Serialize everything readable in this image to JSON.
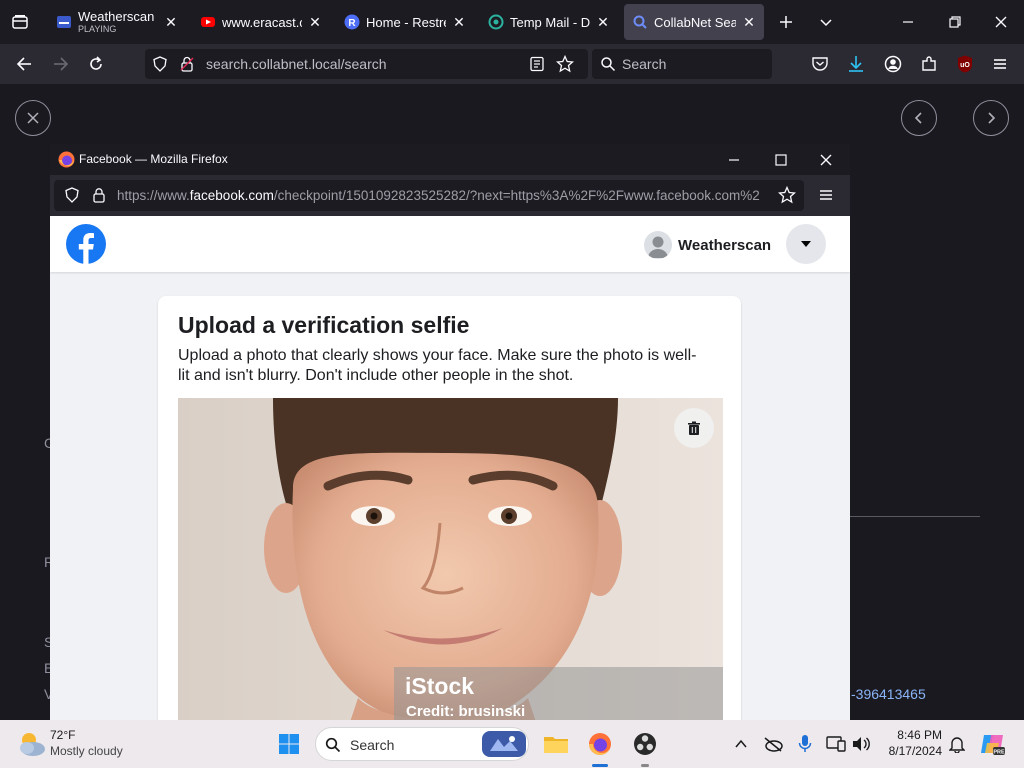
{
  "browser": {
    "tabs": [
      {
        "title": "Weatherscan",
        "subtitle": "PLAYING",
        "icon": "weatherscan-icon",
        "active": false
      },
      {
        "title": "www.eracast.cc",
        "icon": "youtube-icon",
        "active": false
      },
      {
        "title": "Home - Restrea",
        "icon": "restream-icon",
        "active": false
      },
      {
        "title": "Temp Mail - Dis",
        "icon": "tempmail-icon",
        "active": false
      },
      {
        "title": "CollabNet Sear",
        "icon": "search-icon",
        "active": true
      }
    ],
    "address": "search.collabnet.local/search",
    "search_placeholder": "Search"
  },
  "background_page": {
    "link_text": "-396413465",
    "fragment_letters": [
      "C",
      "R",
      "S",
      "E",
      "V"
    ]
  },
  "popup": {
    "window_title": "Facebook — Mozilla Firefox",
    "url_prefix": "https://www.",
    "url_domain": "facebook.com",
    "url_rest": "/checkpoint/1501092823525282/?next=https%3A%2F%2Fwww.facebook.com%2",
    "profile_name": "Weatherscan",
    "card_title": "Upload a verification selfie",
    "card_description": "Upload a photo that clearly shows your face. Make sure the photo is well-lit and isn't blurry. Don't include other people in the shot.",
    "watermark_brand": "iStock",
    "watermark_credit": "Credit: brusinski"
  },
  "taskbar": {
    "weather_temp": "72°F",
    "weather_desc": "Mostly cloudy",
    "search_label": "Search",
    "time": "8:46 PM",
    "date": "8/17/2024"
  },
  "colors": {
    "facebook_blue": "#1877f2",
    "firefox_dark": "#1c1b22",
    "toolbar": "#2b2a33",
    "link": "#8ab4f8"
  }
}
